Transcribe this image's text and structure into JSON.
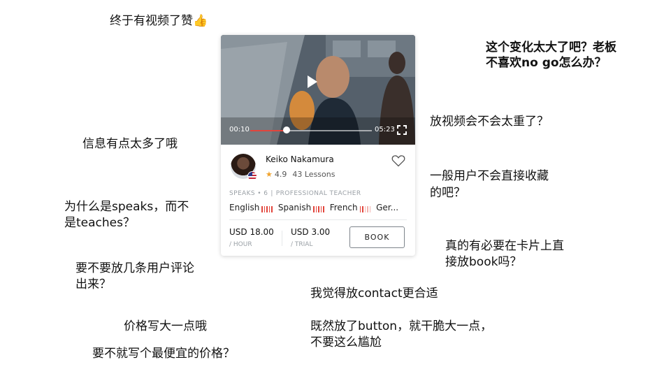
{
  "notes": [
    {
      "id": "n1",
      "text": "终于有视频了赞👍"
    },
    {
      "id": "n2a",
      "text": "这个变化太大了吧？老板"
    },
    {
      "id": "n2b",
      "text": "不喜欢no go怎么办？"
    },
    {
      "id": "n3",
      "text": "放视频会不会太重了？"
    },
    {
      "id": "n4",
      "text": "信息有点太多了哦"
    },
    {
      "id": "n5a",
      "text": "一般用户不会直接收藏"
    },
    {
      "id": "n5b",
      "text": "的吧？"
    },
    {
      "id": "n6a",
      "text": "为什么是speaks，而不"
    },
    {
      "id": "n6b",
      "text": "是teaches？"
    },
    {
      "id": "n7a",
      "text": "真的有必要在卡片上直"
    },
    {
      "id": "n7b",
      "text": "接放book吗？"
    },
    {
      "id": "n8a",
      "text": "要不要放几条用户评论"
    },
    {
      "id": "n8b",
      "text": "出来？"
    },
    {
      "id": "n9",
      "text": "我觉得放contact更合适"
    },
    {
      "id": "n10",
      "text": "价格写大一点哦"
    },
    {
      "id": "n11a",
      "text": "既然放了button，就干脆大一点，"
    },
    {
      "id": "n11b",
      "text": "不要这么尴尬"
    },
    {
      "id": "n12",
      "text": "要不就写个最便宜的价格？"
    }
  ],
  "card": {
    "video": {
      "current_time": "00:10",
      "duration": "05:23",
      "progress": 0.3,
      "play_icon": "play-icon",
      "fullscreen_icon": "fullscreen-icon"
    },
    "tutor": {
      "name": "Keiko Nakamura",
      "rating": "4.9",
      "lessons": "43 Lessons",
      "flag": "us-flag",
      "favorite_icon": "heart-icon"
    },
    "speaks_label": "SPEAKS • 6",
    "role_label": "PROFESSIONAL TEACHER",
    "languages": [
      {
        "name": "English",
        "level": 5
      },
      {
        "name": "Spanish",
        "level": 5
      },
      {
        "name": "French",
        "level": 2
      },
      {
        "name": "Ger...",
        "level": 0
      }
    ],
    "prices": [
      {
        "amount": "USD 18.00",
        "unit": "/ HOUR"
      },
      {
        "amount": "USD 3.00",
        "unit": "/ TRIAL"
      }
    ],
    "book_label": "BOOK",
    "colors": {
      "accent": "#e2453c",
      "star": "#f0a22b"
    }
  }
}
